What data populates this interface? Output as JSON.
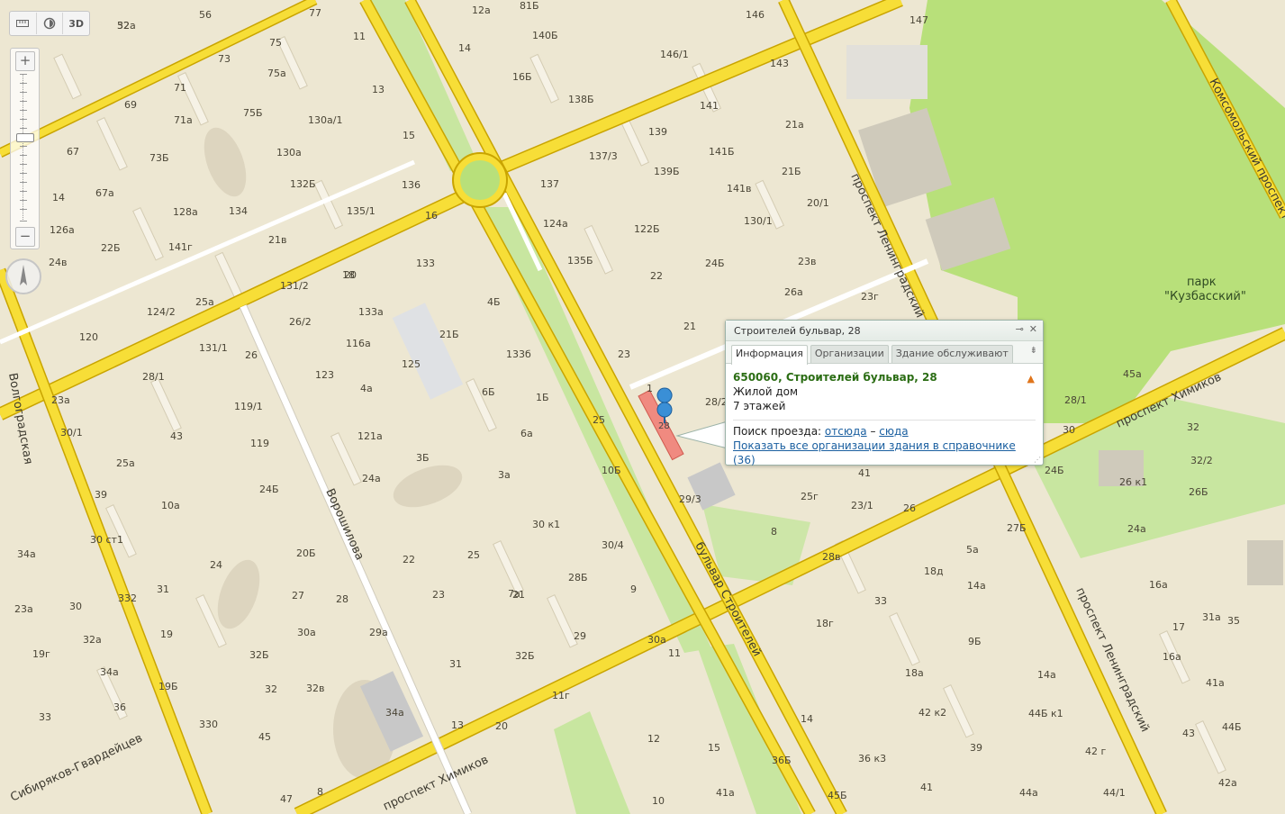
{
  "toolbar": {
    "ruler_icon": "ruler-icon",
    "traffic_icon": "traffic-icon",
    "mode_3d": "3D"
  },
  "zoom": {
    "plus": "+",
    "minus": "−",
    "level_fraction": 0.45
  },
  "compass_icon": "compass-arrow-icon",
  "streets": {
    "leningradsky_n": "проспект Ленинградский",
    "leningradsky_s": "проспект Ленинградский",
    "khimikov_e": "проспект Химиков",
    "khimikov_w": "проспект Химиков",
    "komsomolsky": "Комсомольский проспект",
    "voroshilova": "Ворошилова",
    "stroiteley": "бульвар Строителей",
    "volgogradskaya": "Волгоградская",
    "sibiryakov": "Сибиряков-Гвардейцев"
  },
  "park": {
    "line1": "парк",
    "line2": "\"Кузбасский\""
  },
  "house_numbers": [
    "52a",
    "56",
    "77",
    "11",
    "12a",
    "81Б",
    "146",
    "147",
    "75",
    "73",
    "13",
    "14",
    "140Б",
    "146/1",
    "143",
    "69",
    "71",
    "75a",
    "16Б",
    "138Б",
    "141",
    "21a",
    "67",
    "71a",
    "75Б",
    "130a/1",
    "15",
    "139",
    "141Б",
    "73Б",
    "130a",
    "137/3",
    "21Б",
    "14",
    "67a",
    "132Б",
    "136",
    "137",
    "139Б",
    "141в",
    "126a",
    "128a",
    "134",
    "135/1",
    "16",
    "124a",
    "122Б",
    "130/1",
    "20/1",
    "22Б",
    "141г",
    "21в",
    "18",
    "133",
    "135Б",
    "22",
    "24Б",
    "23в",
    "24в",
    "20",
    "131/2",
    "133a",
    "21Б",
    "26a",
    "23г",
    "25a",
    "124/2",
    "120",
    "116a",
    "4Б",
    "21",
    "26/2",
    "131/1",
    "125",
    "133б",
    "23",
    "26",
    "1",
    "28/1",
    "123",
    "4a",
    "6Б",
    "23a",
    "119/1",
    "1Б",
    "25",
    "28/2",
    "28/1",
    "30",
    "32",
    "30/1",
    "43",
    "119",
    "121a",
    "3Б",
    "6a",
    "10Б",
    "25a",
    "29/3",
    "24Б",
    "32/2",
    "26 к1",
    "41",
    "39",
    "24Б",
    "24a",
    "3a",
    "10a",
    "25г",
    "26Б",
    "34a",
    "30 ст1",
    "30 к1",
    "23/1",
    "26",
    "8",
    "27Б",
    "24a",
    "24",
    "20Б",
    "25",
    "30/4",
    "28в",
    "5a",
    "18д",
    "31",
    "22",
    "23",
    "21",
    "28Б",
    "14a",
    "16a",
    "31a",
    "23a",
    "30",
    "332",
    "27",
    "28",
    "7a",
    "9",
    "18г",
    "33",
    "17",
    "19",
    "32Б",
    "30a",
    "29",
    "30a",
    "9Б",
    "16a",
    "35",
    "19г",
    "32a",
    "29a",
    "32Б",
    "11",
    "14a",
    "41a",
    "34a",
    "31",
    "18a",
    "19Б",
    "32",
    "32в",
    "11г",
    "14",
    "42 к2",
    "44Б к1",
    "43",
    "36",
    "33",
    "330",
    "34a",
    "13",
    "20",
    "12",
    "15",
    "39",
    "44Б",
    "45",
    "36Б",
    "36 к3",
    "42 г",
    "42a",
    "47",
    "8",
    "10",
    "41a",
    "41",
    "44a",
    "45Б",
    "44/1",
    "45a",
    "32"
  ],
  "balloon": {
    "title": "Строителей бульвар, 28",
    "pin_icon": "pin-icon",
    "close_icon": "close-icon",
    "tabs": [
      "Информация",
      "Организации",
      "Здание обслуживают"
    ],
    "tabs_more_icon": "tabs-more-icon",
    "address": "650060, Строителей бульвар, 28",
    "warning_icon": "warning-icon",
    "building_type": "Жилой дом",
    "floors": "7 этажей",
    "route_label": "Поиск проезда:",
    "route_from": "отсюда",
    "route_dash": "–",
    "route_to": "сюда",
    "show_all_link": "Показать все организации здания в справочнике",
    "show_all_count": "(36)"
  },
  "marker": {
    "number": "28",
    "icon": "selected-building-marker-icon"
  }
}
